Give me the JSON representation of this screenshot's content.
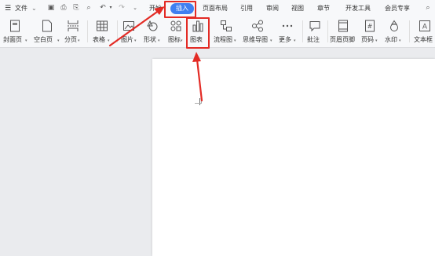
{
  "quickbar": {
    "file_menu": "文件"
  },
  "tabs": [
    "开始",
    "插入",
    "页面布局",
    "引用",
    "审阅",
    "视图",
    "章节",
    "开发工具",
    "会员专享"
  ],
  "active_tab": "插入",
  "ribbon": {
    "cover": "封面页",
    "blank": "空白页",
    "pagebreak": "分页",
    "table": "表格",
    "picture": "图片",
    "shape": "形状",
    "icon": "图标",
    "chart": "图表",
    "flowchart": "流程图",
    "mindmap": "思维导图",
    "more": "更多",
    "comment": "批注",
    "header_footer": "页眉页脚",
    "pagenum": "页码",
    "watermark": "水印",
    "textbox": "文本框"
  },
  "colors": {
    "accent": "#3f7ff1",
    "highlight": "#e32b25"
  }
}
